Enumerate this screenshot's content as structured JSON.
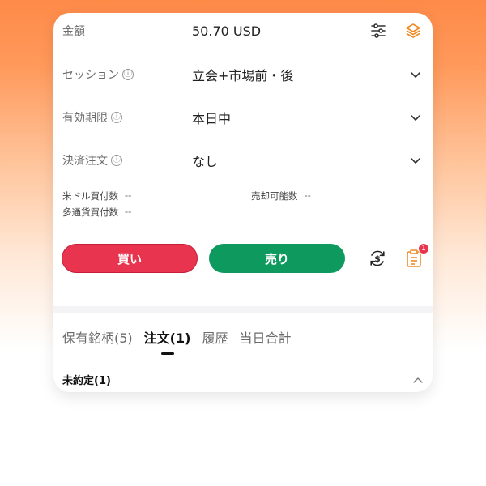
{
  "amount": {
    "label": "金額",
    "value": "50.70 USD"
  },
  "session": {
    "label": "セッション",
    "value": "立会+市場前・後"
  },
  "validity": {
    "label": "有効期限",
    "value": "本日中"
  },
  "settlement": {
    "label": "決済注文",
    "value": "なし"
  },
  "info": {
    "usd_buying_power_label": "米ドル買付数",
    "usd_buying_power_value": "--",
    "multi_currency_label": "多通貨買付数",
    "multi_currency_value": "--",
    "sellable_label": "売却可能数",
    "sellable_value": "--"
  },
  "buttons": {
    "buy": "買い",
    "sell": "売り"
  },
  "badge_count": "1",
  "tabs": [
    {
      "label": "保有銘柄(5)"
    },
    {
      "label": "注文(1)"
    },
    {
      "label": "履歴"
    },
    {
      "label": "当日合計"
    }
  ],
  "section": {
    "title": "未約定(1)"
  },
  "icons": {
    "info": "ⓘ",
    "settings": "sliders-icon",
    "layers": "layers-icon",
    "currency": "dollar-cycle-icon",
    "clipboard": "clipboard-icon",
    "chevron_down": "chevron-down-icon",
    "chevron_up": "chevron-up-icon"
  },
  "colors": {
    "buy": "#e8344e",
    "sell": "#0e9a5e",
    "accent": "#f08a24"
  }
}
